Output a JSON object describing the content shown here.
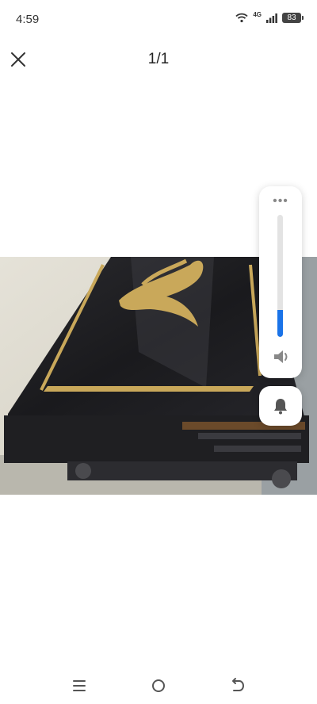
{
  "status_bar": {
    "time": "4:59",
    "network_label": "4G",
    "battery_level": "83",
    "icons": [
      "wifi-icon",
      "signal-icon",
      "battery-icon"
    ]
  },
  "viewer": {
    "page_counter": "1/1",
    "close_icon": "close-icon",
    "photo_subject": "black glossy table top with gold calligraphy inlay"
  },
  "volume_panel": {
    "more_icon": "more-dots-icon",
    "level_fraction": 0.22,
    "accent_color": "#1a73e8",
    "speaker_icon": "speaker-icon",
    "ring_mode_icon": "bell-icon"
  },
  "nav_bar": {
    "icons": [
      "menu-icon",
      "home-icon",
      "back-icon"
    ]
  }
}
